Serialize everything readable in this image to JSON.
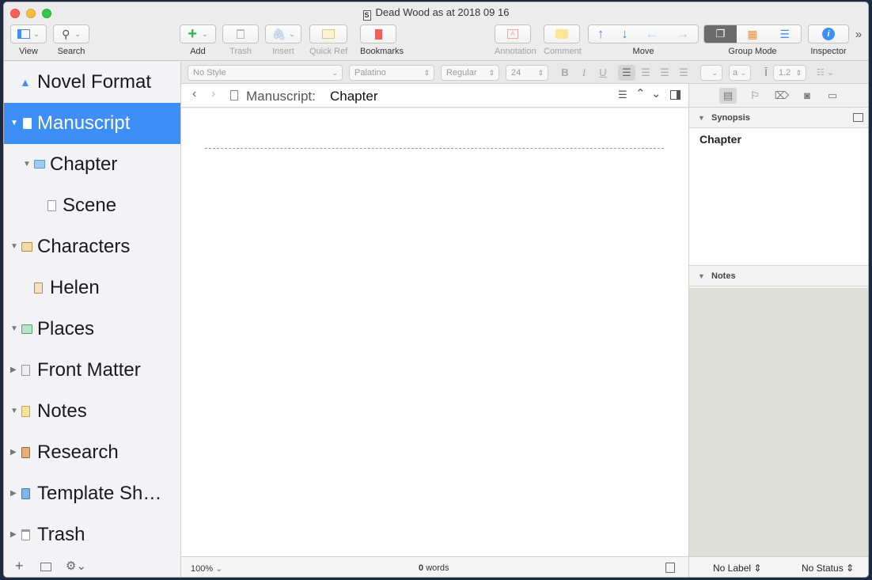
{
  "window": {
    "title": "Dead Wood as at 2018 09 16"
  },
  "toolbar": {
    "view": "View",
    "search": "Search",
    "add": "Add",
    "trash": "Trash",
    "insert": "Insert",
    "quickref": "Quick Ref",
    "bookmarks": "Bookmarks",
    "annotation": "Annotation",
    "comment": "Comment",
    "move": "Move",
    "groupmode": "Group Mode",
    "inspector": "Inspector"
  },
  "format": {
    "style": "No Style",
    "font": "Palatino",
    "weight": "Regular",
    "size": "24",
    "char": "a",
    "spacing": "1.2"
  },
  "binder": {
    "items": [
      {
        "label": "Novel Format"
      },
      {
        "label": "Manuscript"
      },
      {
        "label": "Chapter"
      },
      {
        "label": "Scene"
      },
      {
        "label": "Characters"
      },
      {
        "label": "Helen"
      },
      {
        "label": "Places"
      },
      {
        "label": "Front Matter"
      },
      {
        "label": "Notes"
      },
      {
        "label": "Research"
      },
      {
        "label": "Template Sh…"
      },
      {
        "label": "Trash"
      }
    ]
  },
  "editor": {
    "crumb_parent": "Manuscript:",
    "crumb_current": "Chapter",
    "zoom": "100%",
    "word_count": "0",
    "word_unit": "words"
  },
  "inspector": {
    "synopsis_title": "Synopsis",
    "synopsis_text": "Chapter",
    "notes_title": "Notes",
    "label": "No Label",
    "status": "No Status"
  },
  "colors": {
    "accent": "#3d8ff5",
    "notes_bg": "#dfe0d7"
  }
}
